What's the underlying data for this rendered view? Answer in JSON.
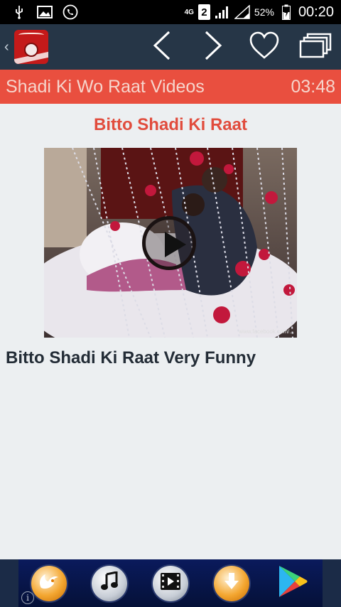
{
  "status_bar": {
    "icons": [
      "usb-icon",
      "image-icon",
      "phone-icon"
    ],
    "network_type": "4G",
    "sim_slot": "2",
    "battery_percent": "52%",
    "time": "00:20"
  },
  "action_bar": {
    "logo": "app-logo",
    "actions": [
      "chevron-left-icon",
      "chevron-right-icon",
      "heart-icon",
      "windows-icon"
    ]
  },
  "title_bar": {
    "title": "Shadi Ki Wo Raat Videos",
    "duration": "03:48"
  },
  "video": {
    "title": "Bitto Shadi Ki Raat",
    "description": "Bitto Shadi Ki Raat Very Funny",
    "watermark": "www.facebook.com/..."
  },
  "ad_bar": {
    "buttons": [
      "uc-browser-icon",
      "music-icon",
      "video-icon",
      "download-icon",
      "play-store-icon"
    ]
  },
  "colors": {
    "action_bar": "#263647",
    "title_bar": "#e94f3f",
    "title_text": "#e14c3d",
    "background": "#eceff1"
  }
}
